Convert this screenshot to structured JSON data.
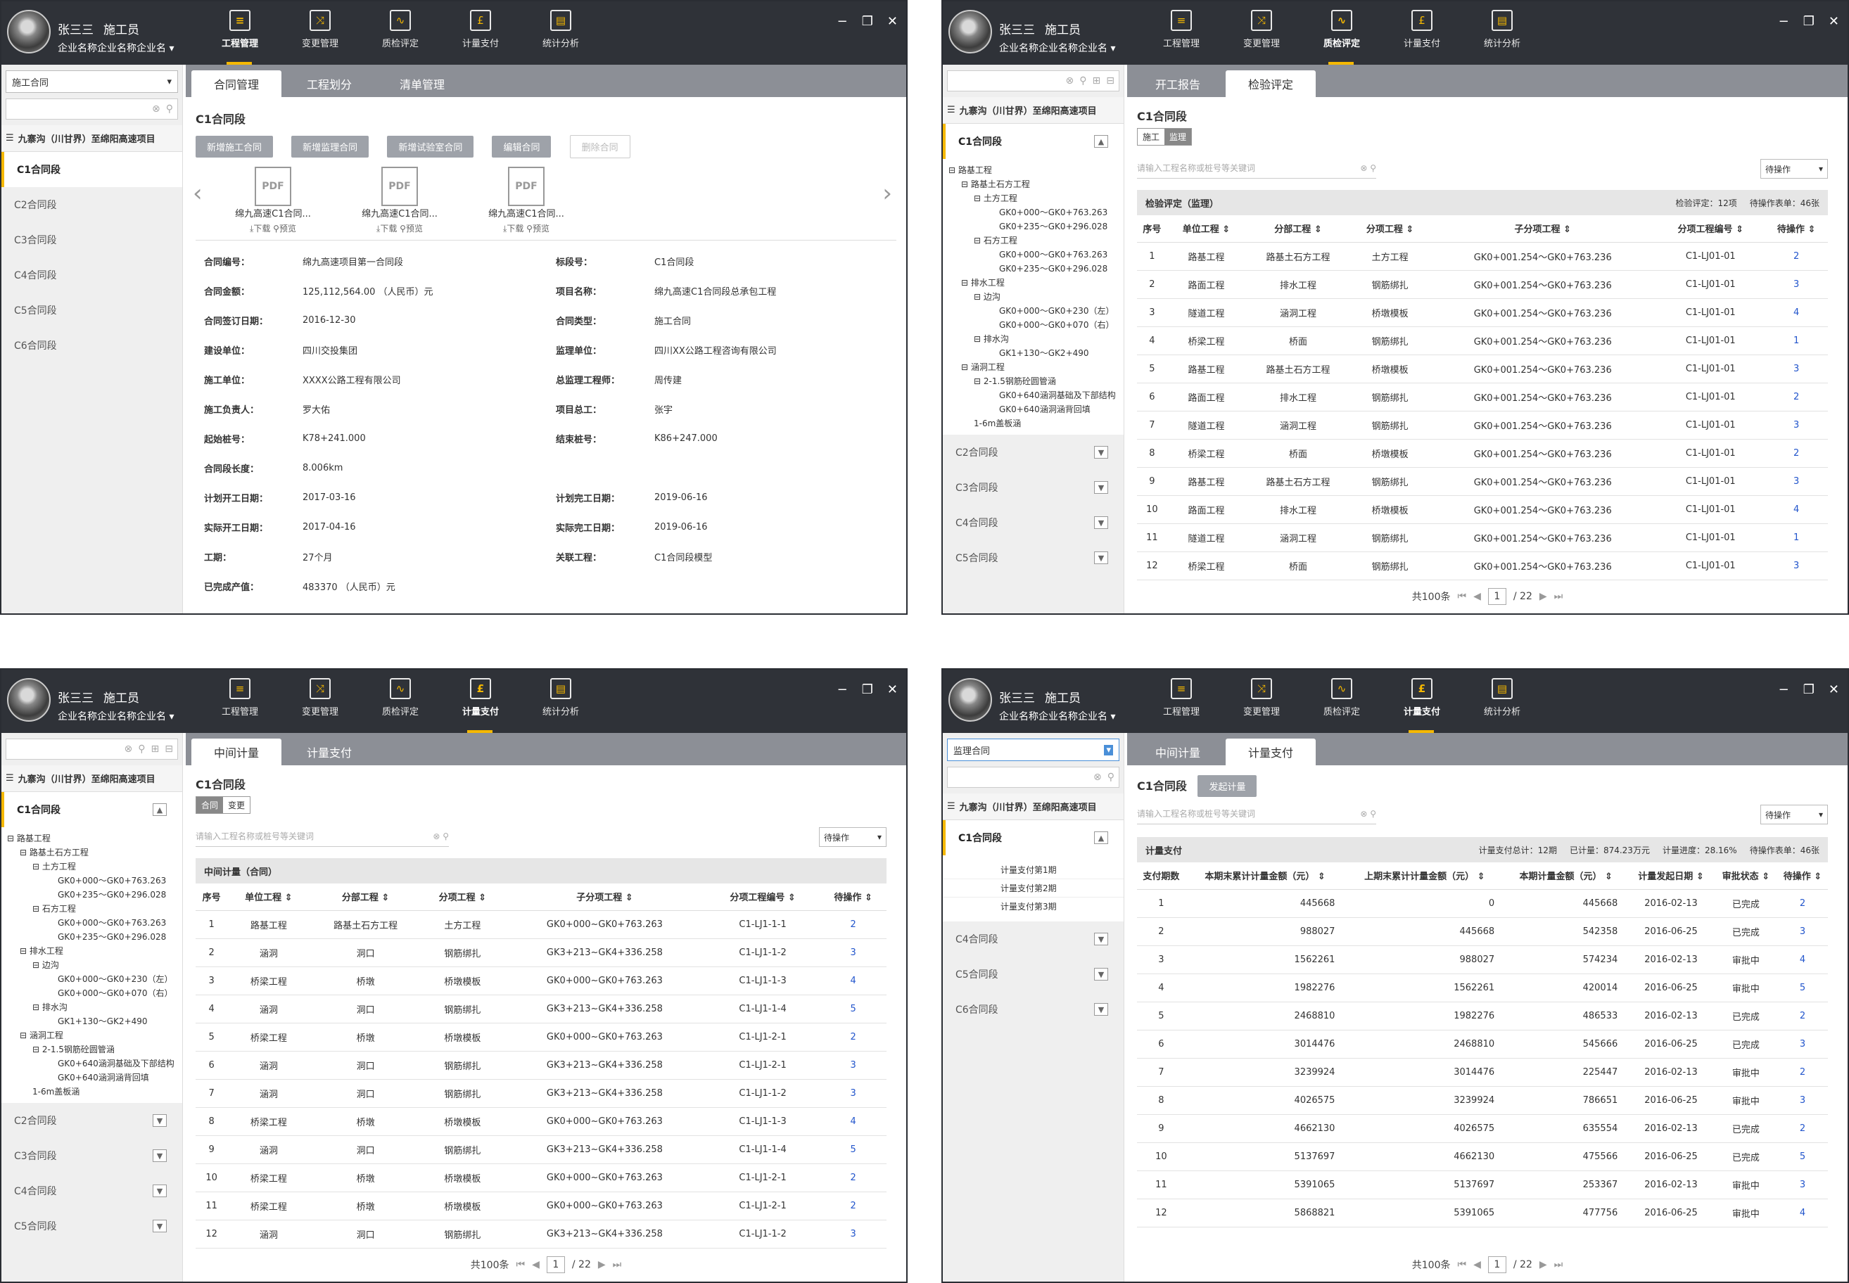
{
  "user": {
    "name": "张三三",
    "role": "施工员",
    "company": "企业名称企业名称企业名"
  },
  "nav": [
    "工程管理",
    "变更管理",
    "质检评定",
    "计量支付",
    "统计分析"
  ],
  "project": "九寨沟（川甘界）至绵阳高速项目",
  "w1": {
    "select": "施工合同",
    "sections": [
      "C1合同段",
      "C2合同段",
      "C3合同段",
      "C4合同段",
      "C5合同段",
      "C6合同段"
    ],
    "tabs": [
      "合同管理",
      "工程划分",
      "清单管理"
    ],
    "title": "C1合同段",
    "buttons": [
      "新增施工合同",
      "新增监理合同",
      "新增试验室合同",
      "编辑合同",
      "删除合同"
    ],
    "files": [
      "绵九高速C1合同...",
      "绵九高速C1合同...",
      "绵九高速C1合同..."
    ],
    "dl": "下载",
    "pv": "预览",
    "info": [
      [
        "合同编号：",
        "绵九高速项目第一合同段",
        "标段号：",
        "C1合同段"
      ],
      [
        "合同金额：",
        "125,112,564.00 （人民币）元",
        "项目名称：",
        "绵九高速C1合同段总承包工程"
      ],
      [
        "合同签订日期：",
        "2016-12-30",
        "合同类型：",
        "施工合同"
      ],
      [
        "建设单位：",
        "四川交投集团",
        "监理单位：",
        "四川XX公路工程咨询有限公司"
      ],
      [
        "施工单位：",
        "XXXX公路工程有限公司",
        "总监理工程师：",
        "周传建"
      ],
      [
        "施工负责人：",
        "罗大佑",
        "项目总工：",
        "张宇"
      ],
      [
        "起始桩号：",
        "K78+241.000",
        "结束桩号：",
        "K86+247.000"
      ],
      [
        "合同段长度：",
        "8.006km",
        "",
        ""
      ],
      [
        "计划开工日期：",
        "2017-03-16",
        "计划完工日期：",
        "2019-06-16"
      ],
      [
        "实际开工日期：",
        "2017-04-16",
        "实际完工日期：",
        "2019-06-16"
      ],
      [
        "工期：",
        "27个月",
        "关联工程：",
        "C1合同段模型"
      ],
      [
        "已完成产值：",
        "483370 （人民币）元",
        "",
        ""
      ]
    ]
  },
  "tree": [
    [
      "t1",
      "⊟ 路基工程"
    ],
    [
      "t2",
      "⊟ 路基土石方工程"
    ],
    [
      "t3",
      "⊟ 土方工程"
    ],
    [
      "t4",
      "GK0+000～GK0+763.263"
    ],
    [
      "t4",
      "GK0+235～GK0+296.028"
    ],
    [
      "t3",
      "⊟ 石方工程"
    ],
    [
      "t4",
      "GK0+000～GK0+763.263"
    ],
    [
      "t4",
      "GK0+235～GK0+296.028"
    ],
    [
      "t2",
      "⊟ 排水工程"
    ],
    [
      "t3",
      "⊟ 边沟"
    ],
    [
      "t4",
      "GK0+000～GK0+230（左）"
    ],
    [
      "t4",
      "GK0+000～GK0+070（右）"
    ],
    [
      "t3",
      "⊟ 排水沟"
    ],
    [
      "t4",
      "GK1+130～GK2+490"
    ],
    [
      "t2",
      "⊟ 涵洞工程"
    ],
    [
      "t3",
      "⊟ 2-1.5钢筋砼圆管涵"
    ],
    [
      "t4",
      "GK0+640涵洞基础及下部结构"
    ],
    [
      "t4",
      "GK0+640涵洞涵背回填"
    ],
    [
      "t3",
      "1-6m盖板涵"
    ]
  ],
  "w2": {
    "tabs": [
      "开工报告",
      "检验评定"
    ],
    "title": "C1合同段",
    "mini": [
      "施工",
      "监理"
    ],
    "kw": "请输入工程名称或桩号等关键词",
    "filter": "待操作",
    "bar": "检验评定（监理）",
    "bar_r": [
      "检验评定：12项",
      "待操作表单：46张"
    ],
    "sections": [
      "C2合同段",
      "C3合同段",
      "C4合同段",
      "C5合同段"
    ],
    "cols": [
      "序号",
      "单位工程",
      "分部工程",
      "分项工程",
      "子分项工程",
      "分项工程编号",
      "待操作"
    ],
    "rows": [
      [
        "1",
        "路基工程",
        "路基土石方工程",
        "土方工程",
        "GK0+001.254～GK0+763.236",
        "C1-LJ01-01",
        "2"
      ],
      [
        "2",
        "路面工程",
        "排水工程",
        "钢筋绑扎",
        "GK0+001.254～GK0+763.236",
        "C1-LJ01-01",
        "3"
      ],
      [
        "3",
        "隧道工程",
        "涵洞工程",
        "桥墩模板",
        "GK0+001.254～GK0+763.236",
        "C1-LJ01-01",
        "4"
      ],
      [
        "4",
        "桥梁工程",
        "桥面",
        "钢筋绑扎",
        "GK0+001.254～GK0+763.236",
        "C1-LJ01-01",
        "1"
      ],
      [
        "5",
        "路基工程",
        "路基土石方工程",
        "桥墩模板",
        "GK0+001.254～GK0+763.236",
        "C1-LJ01-01",
        "3"
      ],
      [
        "6",
        "路面工程",
        "排水工程",
        "钢筋绑扎",
        "GK0+001.254～GK0+763.236",
        "C1-LJ01-01",
        "2"
      ],
      [
        "7",
        "隧道工程",
        "涵洞工程",
        "钢筋绑扎",
        "GK0+001.254～GK0+763.236",
        "C1-LJ01-01",
        "3"
      ],
      [
        "8",
        "桥梁工程",
        "桥面",
        "桥墩模板",
        "GK0+001.254～GK0+763.236",
        "C1-LJ01-01",
        "2"
      ],
      [
        "9",
        "路基工程",
        "路基土石方工程",
        "钢筋绑扎",
        "GK0+001.254～GK0+763.236",
        "C1-LJ01-01",
        "3"
      ],
      [
        "10",
        "路面工程",
        "排水工程",
        "桥墩模板",
        "GK0+001.254～GK0+763.236",
        "C1-LJ01-01",
        "4"
      ],
      [
        "11",
        "隧道工程",
        "涵洞工程",
        "钢筋绑扎",
        "GK0+001.254～GK0+763.236",
        "C1-LJ01-01",
        "1"
      ],
      [
        "12",
        "桥梁工程",
        "桥面",
        "钢筋绑扎",
        "GK0+001.254～GK0+763.236",
        "C1-LJ01-01",
        "3"
      ]
    ]
  },
  "w3": {
    "tabs": [
      "中间计量",
      "计量支付"
    ],
    "title": "C1合同段",
    "mini": [
      "合同",
      "变更"
    ],
    "kw": "请输入工程名称或桩号等关键词",
    "filter": "待操作",
    "bar": "中间计量（合同）",
    "sections": [
      "C2合同段",
      "C3合同段",
      "C4合同段",
      "C5合同段"
    ],
    "cols": [
      "序号",
      "单位工程",
      "分部工程",
      "分项工程",
      "子分项工程",
      "分项工程编号",
      "待操作"
    ],
    "rows": [
      [
        "1",
        "路基工程",
        "路基土石方工程",
        "土方工程",
        "GK0+000~GK0+763.263",
        "C1-LJ1-1-1",
        "2"
      ],
      [
        "2",
        "涵洞",
        "洞口",
        "钢筋绑扎",
        "GK3+213~GK4+336.258",
        "C1-LJ1-1-2",
        "3"
      ],
      [
        "3",
        "桥梁工程",
        "桥墩",
        "桥墩模板",
        "GK0+000~GK0+763.263",
        "C1-LJ1-1-3",
        "4"
      ],
      [
        "4",
        "涵洞",
        "洞口",
        "钢筋绑扎",
        "GK3+213~GK4+336.258",
        "C1-LJ1-1-4",
        "5"
      ],
      [
        "5",
        "桥梁工程",
        "桥墩",
        "桥墩模板",
        "GK0+000~GK0+763.263",
        "C1-LJ1-2-1",
        "2"
      ],
      [
        "6",
        "涵洞",
        "洞口",
        "钢筋绑扎",
        "GK3+213~GK4+336.258",
        "C1-LJ1-2-1",
        "3"
      ],
      [
        "7",
        "涵洞",
        "洞口",
        "钢筋绑扎",
        "GK3+213~GK4+336.258",
        "C1-LJ1-1-2",
        "3"
      ],
      [
        "8",
        "桥梁工程",
        "桥墩",
        "桥墩模板",
        "GK0+000~GK0+763.263",
        "C1-LJ1-1-3",
        "4"
      ],
      [
        "9",
        "涵洞",
        "洞口",
        "钢筋绑扎",
        "GK3+213~GK4+336.258",
        "C1-LJ1-1-4",
        "5"
      ],
      [
        "10",
        "桥梁工程",
        "桥墩",
        "桥墩模板",
        "GK0+000~GK0+763.263",
        "C1-LJ1-2-1",
        "2"
      ],
      [
        "11",
        "桥梁工程",
        "桥墩",
        "桥墩模板",
        "GK0+000~GK0+763.263",
        "C1-LJ1-2-1",
        "2"
      ],
      [
        "12",
        "涵洞",
        "洞口",
        "钢筋绑扎",
        "GK3+213~GK4+336.258",
        "C1-LJ1-1-2",
        "3"
      ]
    ]
  },
  "w4": {
    "select": "监理合同",
    "tabs": [
      "中间计量",
      "计量支付"
    ],
    "title": "C1合同段",
    "start_btn": "发起计量",
    "kw": "请输入工程名称或桩号等关键词",
    "filter": "待操作",
    "bar": "计量支付",
    "bar_r": [
      "计量支付总计：12期",
      "已计量：874.23万元",
      "计量进度：28.16%",
      "待操作表单：46张"
    ],
    "sub": [
      "计量支付第1期",
      "计量支付第2期",
      "计量支付第3期"
    ],
    "sections": [
      "C4合同段",
      "C5合同段",
      "C6合同段"
    ],
    "cols": [
      "支付期数",
      "本期末累计计量金额（元）",
      "上期末累计计量金额（元）",
      "本期计量金额（元）",
      "计量发起日期",
      "审批状态",
      "待操作"
    ],
    "rows": [
      [
        "1",
        "445668",
        "0",
        "445668",
        "2016-02-13",
        "已完成",
        "2"
      ],
      [
        "2",
        "988027",
        "445668",
        "542358",
        "2016-06-25",
        "已完成",
        "3"
      ],
      [
        "3",
        "1562261",
        "988027",
        "574234",
        "2016-02-13",
        "审批中",
        "4"
      ],
      [
        "4",
        "1982276",
        "1562261",
        "420014",
        "2016-06-25",
        "审批中",
        "5"
      ],
      [
        "5",
        "2468810",
        "1982276",
        "486533",
        "2016-02-13",
        "已完成",
        "2"
      ],
      [
        "6",
        "3014476",
        "2468810",
        "545666",
        "2016-06-25",
        "已完成",
        "3"
      ],
      [
        "7",
        "3239924",
        "3014476",
        "225447",
        "2016-02-13",
        "审批中",
        "2"
      ],
      [
        "8",
        "4026575",
        "3239924",
        "786651",
        "2016-06-25",
        "审批中",
        "3"
      ],
      [
        "9",
        "4662130",
        "4026575",
        "635554",
        "2016-02-13",
        "已完成",
        "2"
      ],
      [
        "10",
        "5137697",
        "4662130",
        "475566",
        "2016-06-25",
        "已完成",
        "5"
      ],
      [
        "11",
        "5391065",
        "5137697",
        "253367",
        "2016-02-13",
        "审批中",
        "3"
      ],
      [
        "12",
        "5868821",
        "5391065",
        "477756",
        "2016-06-25",
        "审批中",
        "4"
      ]
    ]
  },
  "pager": {
    "total": "共100条",
    "page": "1",
    "pages": "/ 22"
  }
}
